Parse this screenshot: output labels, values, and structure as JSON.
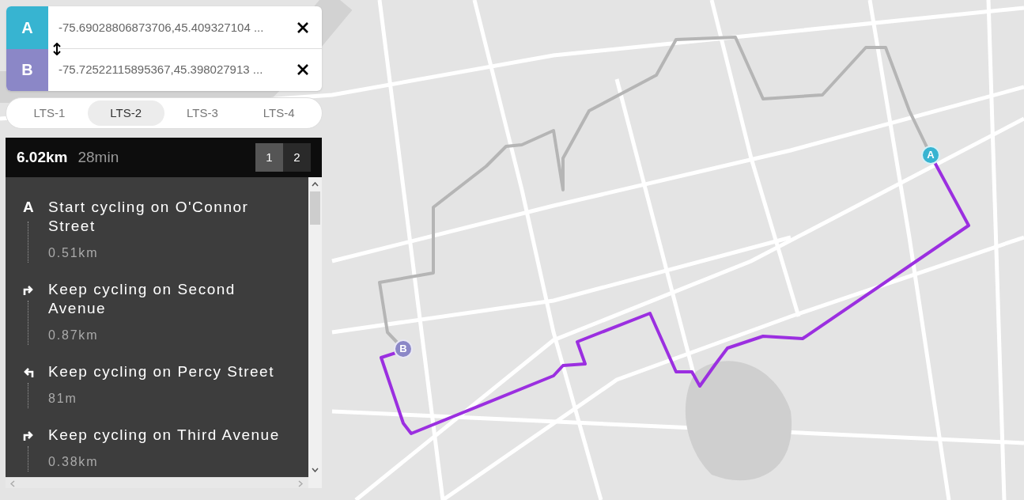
{
  "waypoints": [
    {
      "label": "A",
      "color": "#37b4d1",
      "value": "-75.69028806873706,45.409327104 ..."
    },
    {
      "label": "B",
      "color": "#8b87c7",
      "value": "-75.72522115895367,45.398027913 ..."
    }
  ],
  "lts_tabs": [
    {
      "label": "LTS-1",
      "selected": false
    },
    {
      "label": "LTS-2",
      "selected": true
    },
    {
      "label": "LTS-3",
      "selected": false
    },
    {
      "label": "LTS-4",
      "selected": false
    }
  ],
  "summary": {
    "distance": "6.02km",
    "duration": "28min"
  },
  "route_options": [
    {
      "label": "1",
      "selected": true
    },
    {
      "label": "2",
      "selected": false
    }
  ],
  "steps": [
    {
      "kind": "start",
      "marker": "A",
      "instruction": "Start cycling on O'Connor Street",
      "distance": "0.51km"
    },
    {
      "kind": "right",
      "instruction": "Keep cycling on Second Avenue",
      "distance": "0.87km"
    },
    {
      "kind": "left",
      "instruction": "Keep cycling on Percy Street",
      "distance": "81m"
    },
    {
      "kind": "right",
      "instruction": "Keep cycling on Third Avenue",
      "distance": "0.38km"
    }
  ],
  "map": {
    "markers": [
      {
        "label": "A",
        "color": "#37b4d1"
      },
      {
        "label": "B",
        "color": "#8b87c7"
      }
    ]
  }
}
